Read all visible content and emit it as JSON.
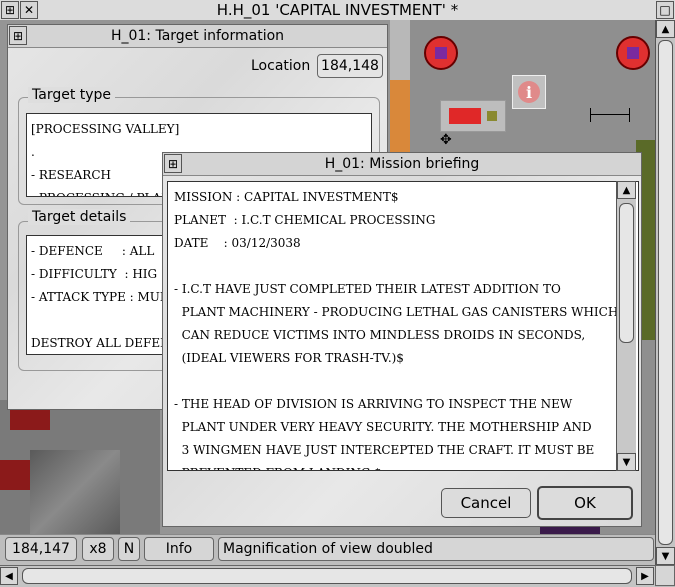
{
  "main_window": {
    "title": "H.H_01 'CAPITAL INVESTMENT' *"
  },
  "target_window": {
    "title": "H_01: Target information",
    "location_label": "Location",
    "location_value": "184,148",
    "target_type_label": "Target type",
    "target_type_lines": [
      "[PROCESSING VALLEY]",
      ".",
      "- RESEARCH",
      "- PROCESSING / PLANT"
    ],
    "target_details_label": "Target details",
    "target_details_lines": [
      "- DEFENCE     : ALL",
      "- DIFFICULTY  : HIG",
      "- ATTACK TYPE : MUL",
      "",
      "DESTROY ALL DEFENCE"
    ]
  },
  "mission_window": {
    "title": "H_01: Mission briefing",
    "lines": [
      "MISSION : CAPITAL INVESTMENT$",
      "PLANET  : I.C.T CHEMICAL PROCESSING",
      "DATE    : 03/12/3038",
      "",
      "- I.C.T HAVE JUST COMPLETED THEIR LATEST ADDITION TO",
      "  PLANT MACHINERY - PRODUCING LETHAL GAS CANISTERS WHICH",
      "  CAN REDUCE VICTIMS INTO MINDLESS DROIDS IN SECONDS,",
      "  (IDEAL VIEWERS FOR TRASH-TV.)$",
      "",
      "- THE HEAD OF DIVISION IS ARRIVING TO INSPECT THE NEW",
      "  PLANT UNDER VERY HEAVY SECURITY. THE MOTHERSHIP AND",
      "  3 WINGMEN HAVE JUST INTERCEPTED THE CRAFT. IT MUST BE",
      "  PREVENTED FROM LANDING.$"
    ],
    "cancel_label": "Cancel",
    "ok_label": "OK"
  },
  "status_bar": {
    "coords": "184,147",
    "zoom": "x8",
    "mode": "N",
    "info_label": "Info",
    "message": "Magnification of view doubled"
  },
  "colors": {
    "title_bar": "#dcdcdc",
    "map_red": "#8b1a1a",
    "map_orange": "#d98a2a",
    "map_green": "#5a6a28",
    "marker_red": "#e03030",
    "marker_purple": "#7a2aa0"
  },
  "icons": [
    "close-icon",
    "back-icon",
    "toggle-size-icon",
    "scroll-up-icon",
    "scroll-down-icon",
    "scroll-left-icon",
    "scroll-right-icon",
    "info-icon",
    "turret-icon",
    "cursor-icon"
  ]
}
